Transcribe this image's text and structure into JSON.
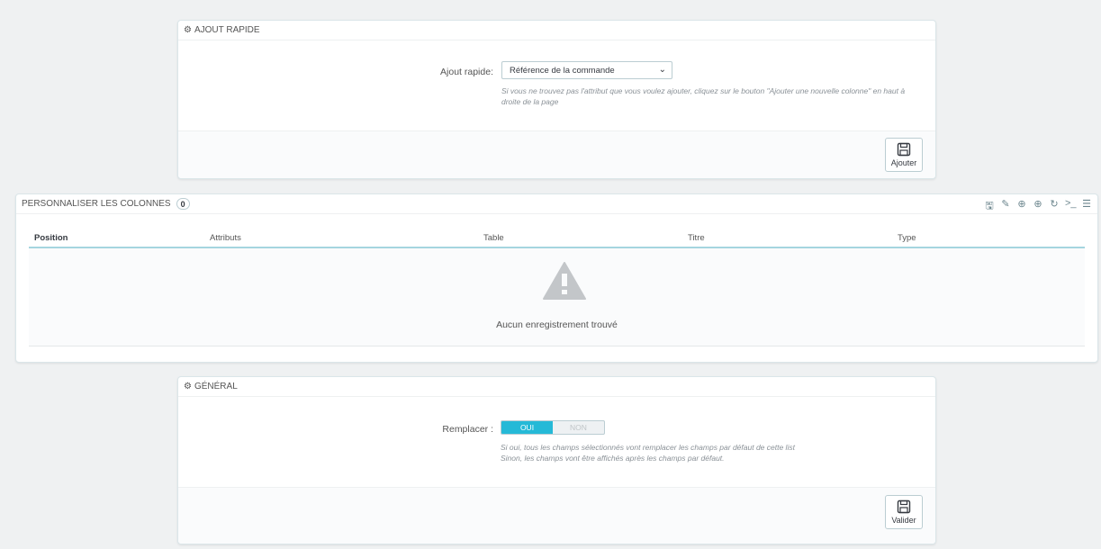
{
  "quick_add": {
    "title": "AJOUT RAPIDE",
    "label": "Ajout rapide:",
    "selected": "Référence de la commande",
    "help_line1": "Si vous ne trouvez pas l'attribut que vous voulez ajouter, cliquez sur le bouton \"Ajouter une nouvelle colonne\" en haut à",
    "help_line2": "droite de la page",
    "button": "Ajouter"
  },
  "columns": {
    "title": "PERSONNALISER LES COLONNES",
    "count": "0",
    "headers": [
      "Position",
      "Attributs",
      "Table",
      "Titre",
      "Type"
    ],
    "empty_text": "Aucun enregistrement trouvé",
    "toolbar_icons": [
      "save-icon",
      "edit-icon",
      "download-icon",
      "add-icon",
      "refresh-icon",
      "terminal-icon",
      "database-icon"
    ]
  },
  "general": {
    "title": "GÉNÉRAL",
    "label": "Remplacer :",
    "switch_on": "OUI",
    "switch_off": "NON",
    "help_line1": "Si oui, tous les champs sélectionnés vont remplacer les champs par défaut de cette list",
    "help_line2": "Sinon, les champs vont être affichés après les champs par défaut.",
    "button": "Valider"
  }
}
